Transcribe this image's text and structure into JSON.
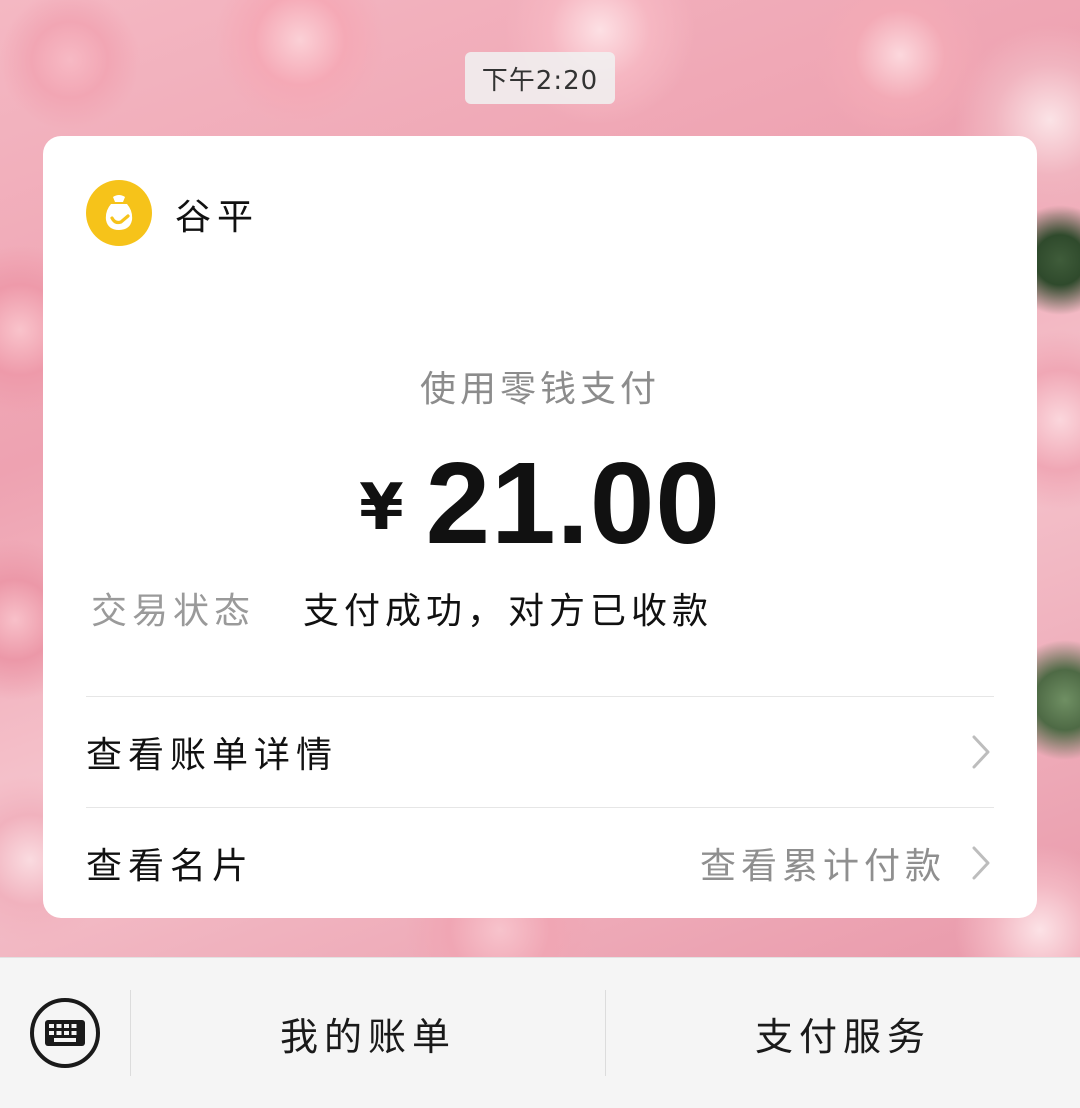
{
  "status_bar": {
    "time": "下午2:20"
  },
  "merchant": {
    "name": "谷平",
    "logo_icon": "wallet-bag-icon",
    "logo_color": "#f6c31a"
  },
  "payment": {
    "method": "使用零钱支付",
    "currency_symbol": "¥",
    "amount": "21.00",
    "status_label": "交易状态",
    "status_value": "支付成功，对方已收款"
  },
  "links": {
    "bill_details": "查看账单详情",
    "business_card": "查看名片",
    "cumulative_payments": "查看累计付款"
  },
  "bottom_bar": {
    "keyboard_icon": "keyboard-icon",
    "my_bills": "我的账单",
    "pay_services": "支付服务"
  }
}
